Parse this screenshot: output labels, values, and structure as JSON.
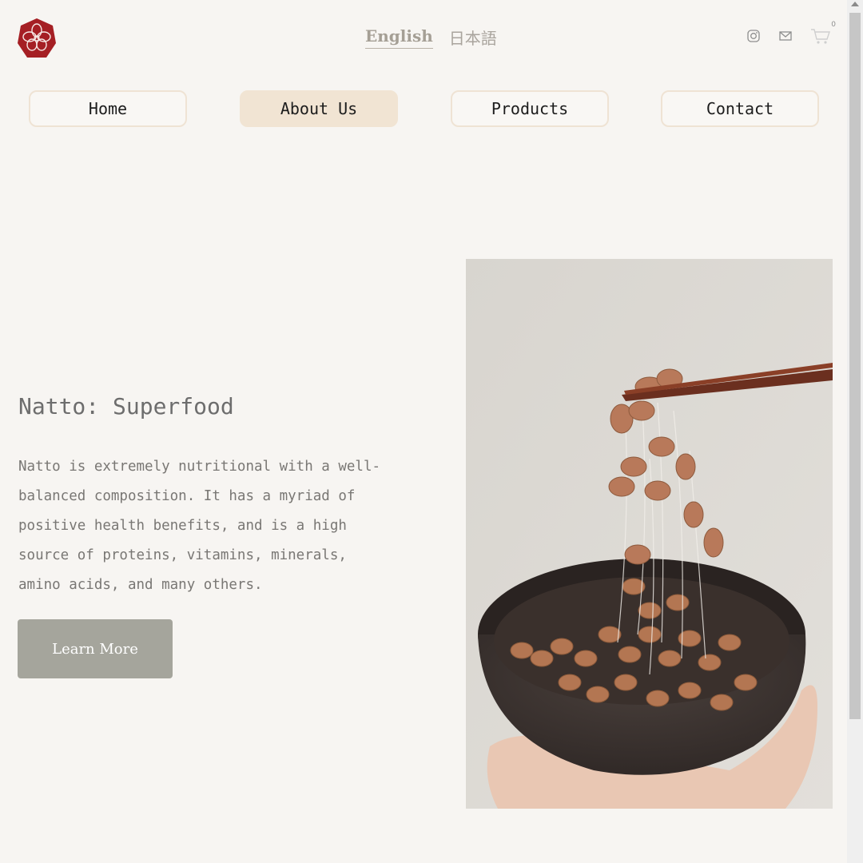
{
  "header": {
    "logo_icon": "camellia-crest-logo",
    "languages": [
      {
        "label": "English",
        "active": true
      },
      {
        "label": "日本語",
        "active": false
      }
    ],
    "icons": [
      "instagram-icon",
      "mail-icon",
      "cart-icon"
    ],
    "cart_count": "0"
  },
  "nav": {
    "items": [
      {
        "label": "Home"
      },
      {
        "label": "About Us"
      },
      {
        "label": "Products"
      },
      {
        "label": "Contact"
      }
    ],
    "active_item": "About Us"
  },
  "hero": {
    "title": "Natto: Superfood",
    "body": "Natto is extremely nutritional with a well-balanced composition. It has a myriad of positive health benefits, and is a high source of proteins, vitamins, minerals, amino acids, and many others.",
    "cta_label": "Learn More",
    "image_subject": "natto-bowl-chopsticks-photo"
  },
  "colors": {
    "background": "#f7f5f2",
    "accent_crimson": "#a51f24",
    "nav_active": "#f1e4d3",
    "button_gray": "#a5a59c"
  }
}
